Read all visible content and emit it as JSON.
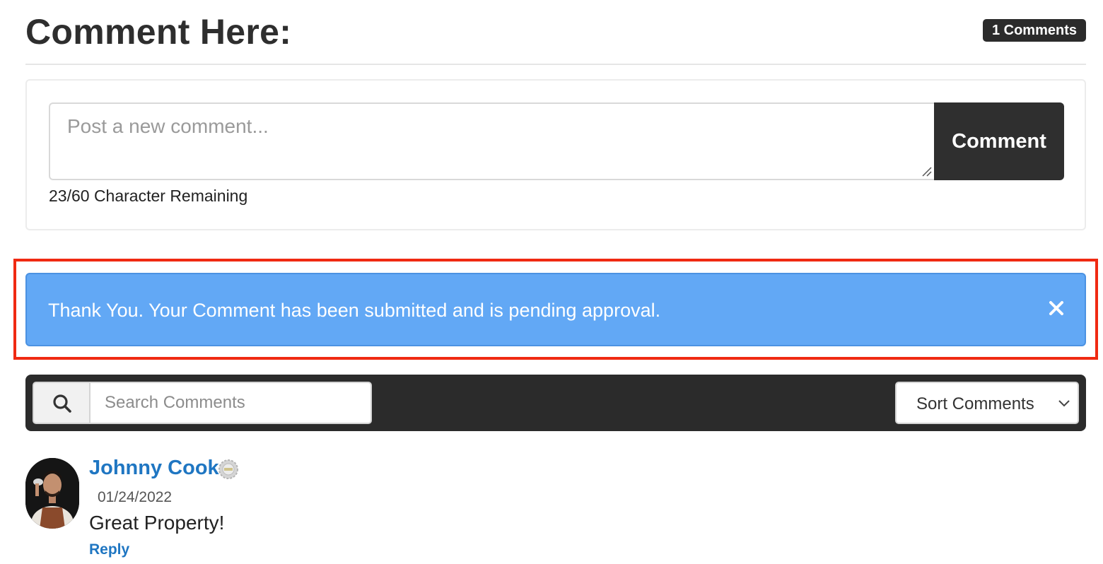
{
  "header": {
    "title": "Comment Here:",
    "comment_count": "1 Comments"
  },
  "composer": {
    "placeholder": "Post a new comment...",
    "button_label": "Comment",
    "char_remaining": "23/60 Character Remaining"
  },
  "alert": {
    "message": "Thank You. Your Comment has been submitted and is pending approval.",
    "close_icon": "close-icon",
    "color": "#62a8f5",
    "highlight_color": "#f02a12"
  },
  "toolbar": {
    "search_icon": "search-icon",
    "search_placeholder": "Search Comments",
    "sort_label": "Sort Comments",
    "sort_icon": "chevron-down-icon"
  },
  "comments": [
    {
      "author": "Johnny Cook",
      "badge_icon": "verified-badge-icon",
      "date": "01/24/2022",
      "text": "Great Property!",
      "reply_label": "Reply"
    }
  ],
  "colors": {
    "dark": "#2b2b2b",
    "link": "#1f76c2"
  }
}
